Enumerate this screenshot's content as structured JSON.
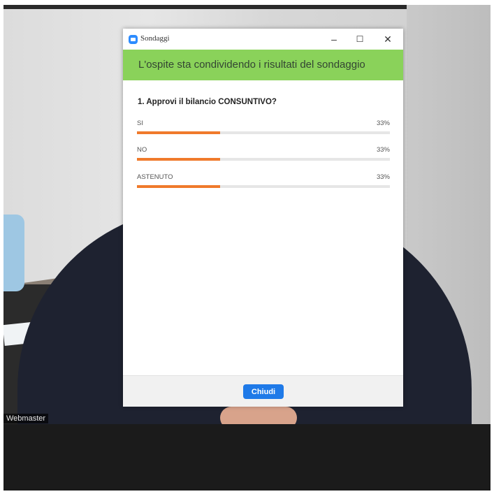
{
  "window": {
    "title": "Sondaggi"
  },
  "banner": {
    "text": "L'ospite sta condividendo i risultati del sondaggio"
  },
  "question": "1. Approvi il bilancio CONSUNTIVO?",
  "options": [
    {
      "label": "SI",
      "percent_text": "33%",
      "value": 33
    },
    {
      "label": "NO",
      "percent_text": "33%",
      "value": 33
    },
    {
      "label": "ASTENUTO",
      "percent_text": "33%",
      "value": 33
    }
  ],
  "footer": {
    "close_label": "Chiudi"
  },
  "video": {
    "participant_name": "Webmaster"
  },
  "colors": {
    "banner": "#8ad25a",
    "bar_fill": "#f07a2b",
    "button": "#1f7ae8"
  }
}
